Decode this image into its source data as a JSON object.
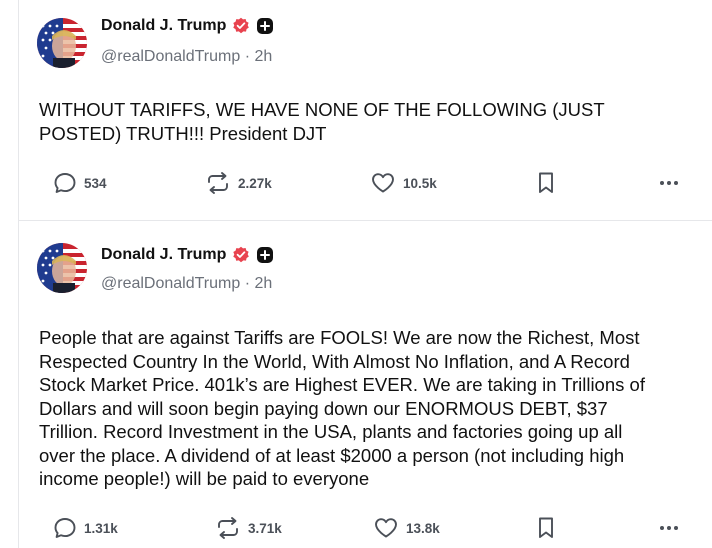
{
  "posts": [
    {
      "author": "Donald J. Trump",
      "handle": "@realDonaldTrump",
      "time": "2h",
      "body": "WITHOUT TARIFFS, WE HAVE NONE OF THE FOLLOWING (JUST\nPOSTED) TRUTH!!! President DJT",
      "replies": "534",
      "retruths": "2.27k",
      "likes": "10.5k"
    },
    {
      "author": "Donald J. Trump",
      "handle": "@realDonaldTrump",
      "time": "2h",
      "body": "People that are against Tariffs are FOOLS! We are now the Richest, Most\nRespected Country In the World, With Almost No Inflation, and A Record\nStock Market Price. 401k’s are Highest EVER. We are taking in Trillions of\nDollars and will soon begin paying down our ENORMOUS DEBT, $37\nTrillion. Record Investment in the USA, plants and factories going up all\nover the place. A dividend of at least $2000 a person (not including high\nincome people!) will be paid to everyone",
      "replies": "1.31k",
      "retruths": "3.71k",
      "likes": "13.8k"
    }
  ],
  "icons": {
    "verified": "verified-badge-icon",
    "plus": "plus-badge-icon",
    "reply": "reply-bubble-icon",
    "retruth": "retruth-arrows-icon",
    "like": "heart-icon",
    "bookmark": "bookmark-icon",
    "more": "more-dots-icon"
  },
  "colors": {
    "verified": "#e8434f",
    "text": "#111111",
    "muted": "#6b7079",
    "icon": "#4b5058",
    "divider": "#e6e7ea"
  },
  "handle_separator": "·"
}
